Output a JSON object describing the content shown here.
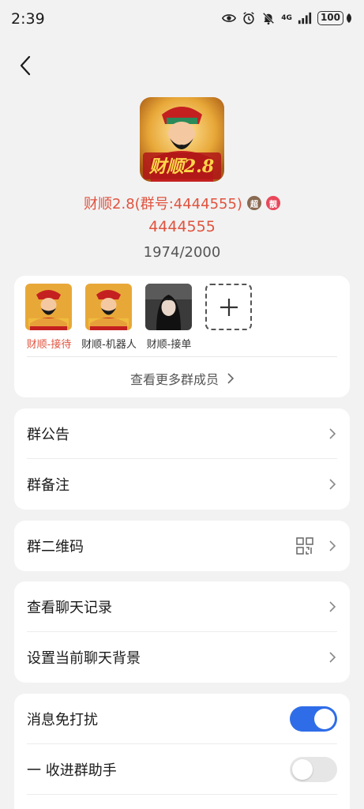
{
  "status_bar": {
    "time": "2:39",
    "battery": "100",
    "network": "4G"
  },
  "group": {
    "name": "财顺2.8(群号:4444555)",
    "badge_super": "超",
    "badge_vip": "靓",
    "id": "4444555",
    "member_count": "1974/2000",
    "avatar_text": "财顺2.8"
  },
  "members": [
    {
      "name": "财顺-接待",
      "accent": true
    },
    {
      "name": "财顺-机器人",
      "accent": false
    },
    {
      "name": "财顺-接单",
      "accent": false
    }
  ],
  "more_members_label": "查看更多群成员",
  "settings": {
    "announcement": "群公告",
    "remark": "群备注",
    "qr_code": "群二维码",
    "chat_history": "查看聊天记录",
    "chat_background": "设置当前聊天背景",
    "do_not_disturb": "消息免打扰",
    "fold_assistant": "一 收进群助手"
  },
  "toggles": {
    "do_not_disturb": true,
    "fold_assistant": false
  },
  "colors": {
    "accent": "#e0533f",
    "toggle_on": "#2f6de8",
    "background": "#f2f2f2"
  }
}
